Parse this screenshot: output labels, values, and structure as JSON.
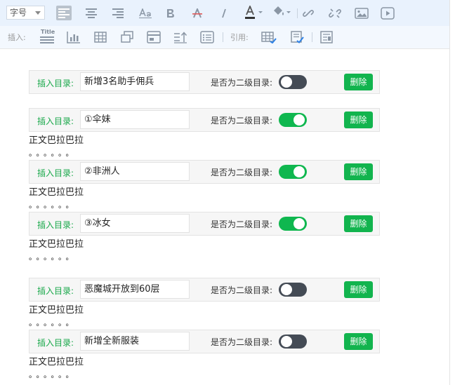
{
  "toolbar": {
    "font_size_label": "字号",
    "insert_label": "插入:",
    "quote_label": "引用:",
    "title_icon_text": "Title"
  },
  "rows": [
    {
      "label": "插入目录:",
      "value": "新增3名助手佣兵",
      "question": "是否为二级目录:",
      "secondary": false,
      "delete": "删除"
    },
    {
      "label": "插入目录:",
      "value": "①伞妹",
      "question": "是否为二级目录:",
      "secondary": true,
      "delete": "删除"
    },
    {
      "label": "插入目录:",
      "value": "②非洲人",
      "question": "是否为二级目录:",
      "secondary": true,
      "delete": "删除"
    },
    {
      "label": "插入目录:",
      "value": "③冰女",
      "question": "是否为二级目录:",
      "secondary": true,
      "delete": "删除"
    },
    {
      "label": "插入目录:",
      "value": "恶魔城开放到60层",
      "question": "是否为二级目录:",
      "secondary": false,
      "delete": "删除"
    },
    {
      "label": "插入目录:",
      "value": "新增全新服装",
      "question": "是否为二级目录:",
      "secondary": false,
      "delete": "删除"
    }
  ],
  "paragraphs": [
    {
      "text": "正文巴拉巴拉",
      "dots": "。。。。。。"
    },
    {
      "text": "正文巴拉巴拉",
      "dots": "。。。。。。"
    },
    {
      "text": "正文巴拉巴拉",
      "dots": "。。。。。。"
    },
    {
      "text": "正文巴拉巴拉",
      "dots": "。。。。。。"
    },
    {
      "text": "正文巴拉巴拉",
      "dots": "。。。。。。"
    }
  ],
  "colors": {
    "accent_green": "#12b44e",
    "toggle_off": "#444b55",
    "toolbar_bg": "#e9f2fd"
  }
}
